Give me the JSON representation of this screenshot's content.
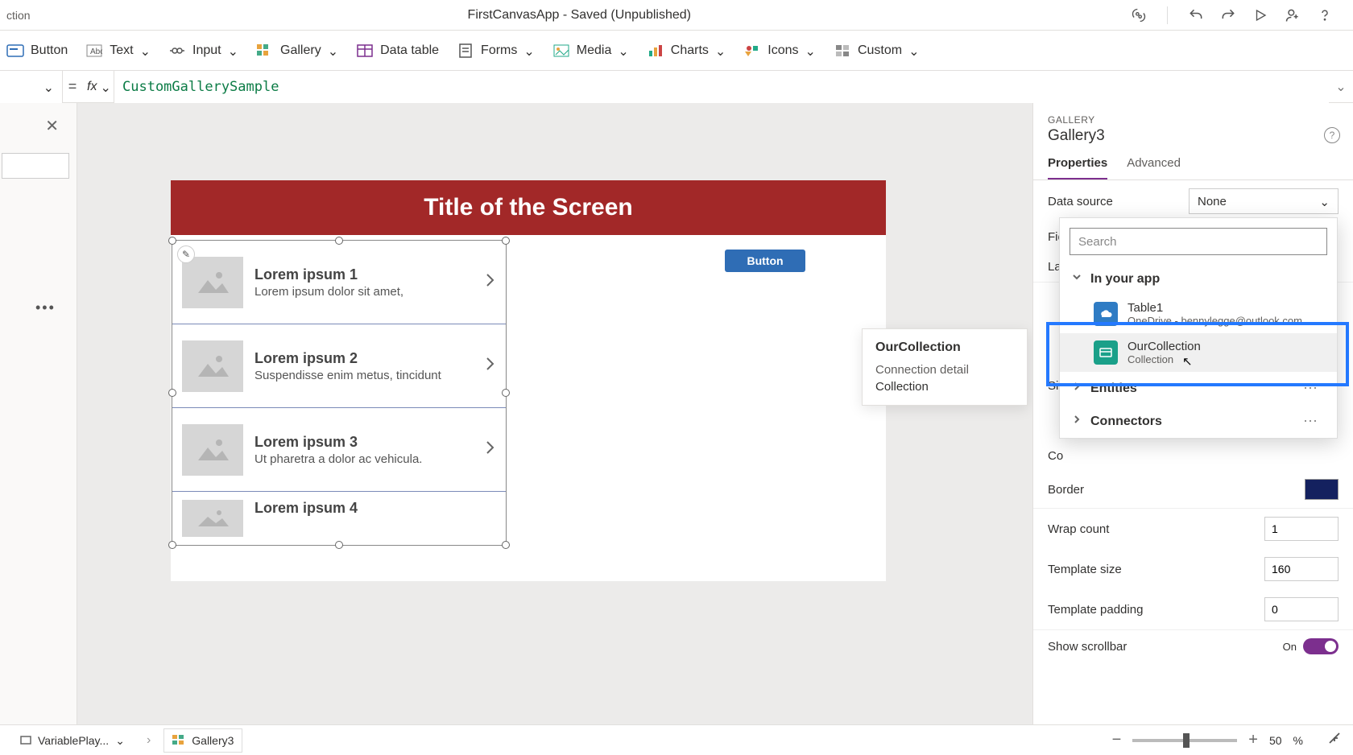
{
  "titlebar": {
    "tab_partial": "ction",
    "app_title": "FirstCanvasApp - Saved (Unpublished)"
  },
  "ribbon": {
    "button": "Button",
    "text": "Text",
    "input": "Input",
    "gallery": "Gallery",
    "data_table": "Data table",
    "forms": "Forms",
    "media": "Media",
    "charts": "Charts",
    "icons": "Icons",
    "custom": "Custom"
  },
  "formula": {
    "value": "CustomGallerySample"
  },
  "canvas": {
    "screen_title": "Title of the Screen",
    "button_label": "Button",
    "gallery_items": [
      {
        "title": "Lorem ipsum 1",
        "sub": "Lorem ipsum dolor sit amet,"
      },
      {
        "title": "Lorem ipsum 2",
        "sub": "Suspendisse enim metus, tincidunt"
      },
      {
        "title": "Lorem ipsum 3",
        "sub": "Ut pharetra a dolor ac vehicula."
      },
      {
        "title": "Lorem ipsum 4",
        "sub": ""
      }
    ]
  },
  "tooltip": {
    "title": "OurCollection",
    "line2": "Connection detail",
    "line3": "Collection"
  },
  "breadcrumb": {
    "item0": "VariablePlay...",
    "item1": "Gallery3"
  },
  "zoom": {
    "pct": "50",
    "unit": "%"
  },
  "rightpane": {
    "category": "GALLERY",
    "name": "Gallery3",
    "tabs": {
      "properties": "Properties",
      "advanced": "Advanced"
    },
    "rows": {
      "data_source": "Data source",
      "data_source_value": "None",
      "fie": "Fie",
      "la": "La",
      "siz": "Siz",
      "co": "Co",
      "border": "Border",
      "wrap_count_label": "Wrap count",
      "wrap_count_value": "1",
      "template_size_label": "Template size",
      "template_size_value": "160",
      "template_padding_label": "Template padding",
      "template_padding_value": "0",
      "show_scrollbar_label": "Show scrollbar",
      "show_scrollbar_on": "On"
    }
  },
  "dropdown": {
    "search_placeholder": "Search",
    "section_in_your_app": "In your app",
    "table1_name": "Table1",
    "table1_sub": "OneDrive - bennylegge@outlook.com",
    "ourcollection_name": "OurCollection",
    "ourcollection_sub": "Collection",
    "entities": "Entities",
    "connectors": "Connectors"
  },
  "colors": {
    "accent": "#7c2f8e",
    "highlight": "#2479ff",
    "header": "#a22828"
  }
}
